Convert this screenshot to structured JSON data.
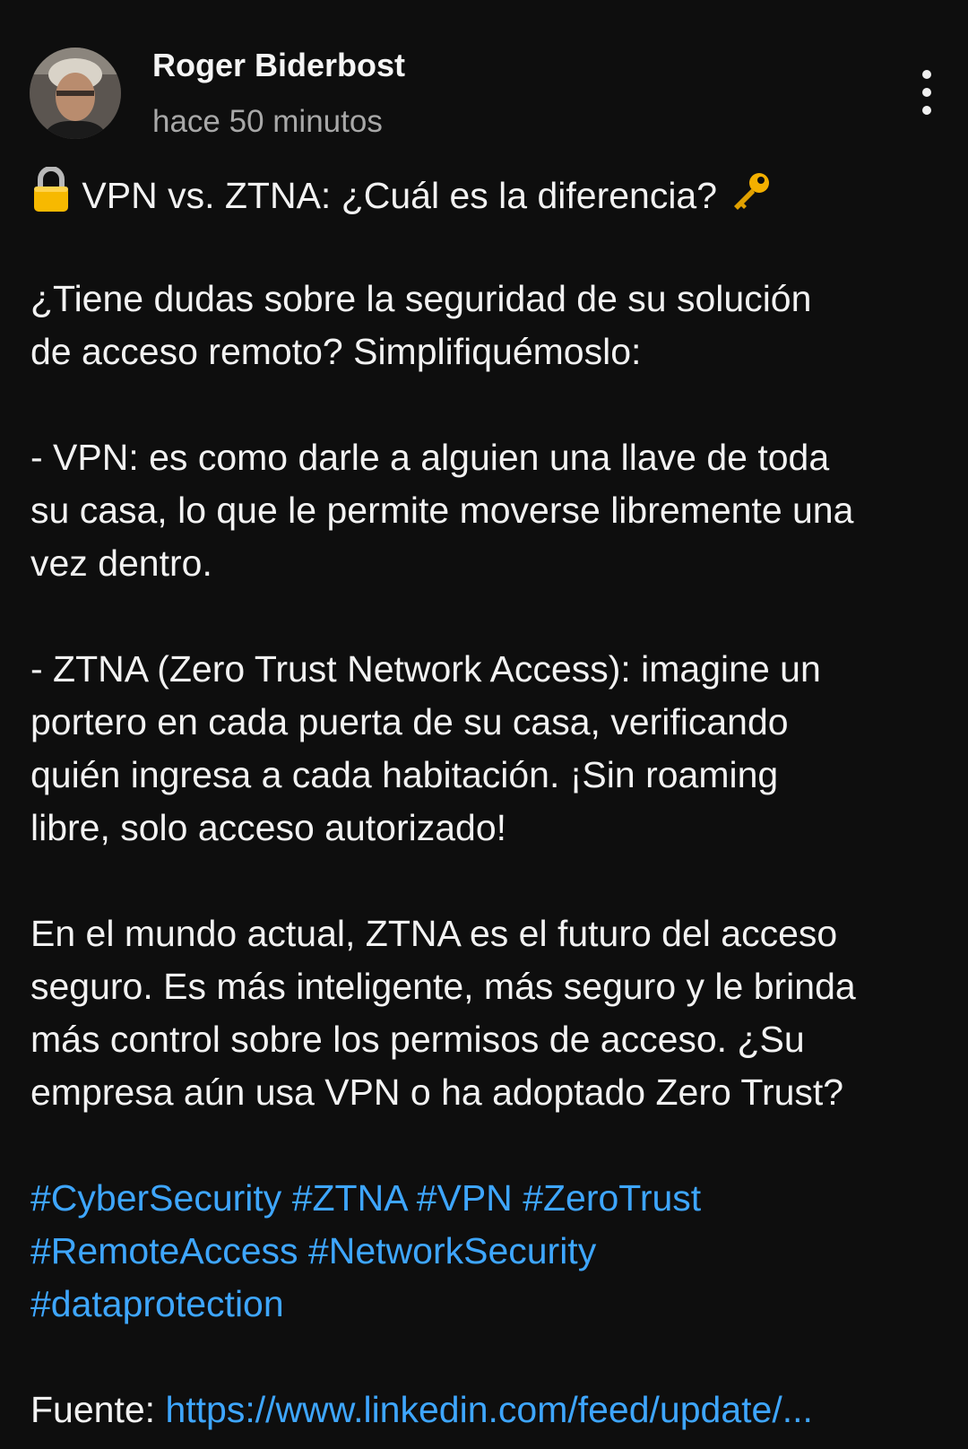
{
  "post": {
    "author": "Roger Biderbost",
    "timestamp": "hace 50 minutos",
    "menu_icon": "vertical-dots-icon",
    "title_text": "VPN vs. ZTNA: ¿Cuál es la diferencia?",
    "title_icons": [
      "lock-icon",
      "key-icon"
    ],
    "paragraph_1": [
      "¿Tiene dudas sobre la seguridad de su solución",
      "de acceso remoto? Simplifiquémoslo:"
    ],
    "paragraph_2": [
      "- VPN: es como darle a alguien una llave de toda",
      "su casa, lo que le permite moverse libremente una",
      "vez dentro."
    ],
    "paragraph_3": [
      "- ZTNA (Zero Trust Network Access): imagine un",
      "portero en cada puerta de su casa, verificando",
      "quién ingresa a cada habitación. ¡Sin roaming",
      "libre, solo acceso autorizado!"
    ],
    "paragraph_4": [
      "En el mundo actual, ZTNA es el futuro del acceso",
      "seguro. Es más inteligente, más seguro y le brinda",
      "más control sobre los permisos de acceso. ¿Su",
      "empresa aún usa VPN o ha adoptado Zero Trust?"
    ],
    "hashtags": [
      "#CyberSecurity",
      "#ZTNA",
      "#VPN",
      "#ZeroTrust",
      "#RemoteAccess",
      "#NetworkSecurity",
      "#dataprotection"
    ],
    "source_label": "Fuente:",
    "source_link": "https://www.linkedin.com/feed/update/..."
  },
  "colors": {
    "background": "#0e0e0e",
    "text": "#f2f2f2",
    "secondary_text": "#a8a8a8",
    "link": "#3ea6ff"
  }
}
